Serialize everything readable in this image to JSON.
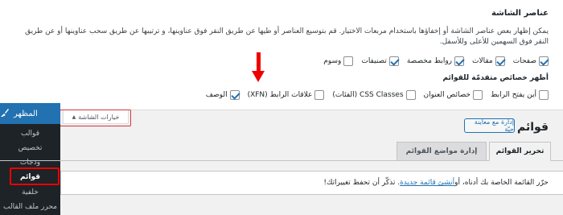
{
  "screen_options": {
    "title": "عناصر الشاشة",
    "description": "يمكن إظهار بعض عناصر الشاشة أو إخفاؤها باستخدام مربعات الاختيار. قم بتوسيع العناصر أو طيها عن طريق النقر فوق عناوينها، و ترتيبها عن طريق سحب عناوينها أو عن طريق النقر فوق السهمين للأعلى وللأسفل.",
    "boxes": [
      {
        "label": "صفحات",
        "checked": true
      },
      {
        "label": "مقالات",
        "checked": true
      },
      {
        "label": "روابط مخصصة",
        "checked": true
      },
      {
        "label": "تصنيفات",
        "checked": true
      },
      {
        "label": "وسوم",
        "checked": false
      }
    ],
    "advanced_title": "أظهر خصائص متقدمّة للقوائم",
    "advanced": [
      {
        "label": "أين يفتح الرابط",
        "checked": false
      },
      {
        "label": "خصائص العنوان",
        "checked": false
      },
      {
        "label": "CSS Classes (الفئات)",
        "checked": false
      },
      {
        "label": "علاقات الرابط (XFN)",
        "checked": false
      },
      {
        "label": "الوصف",
        "checked": true
      }
    ],
    "toggle_label": "خيارات الشاشة",
    "toggle_icon": "arrow-up-icon"
  },
  "sidebar": {
    "menu_label": "المظهر",
    "menu_icon": "paintbrush-icon",
    "items": [
      {
        "label": "قوالب",
        "current": false
      },
      {
        "label": "تخصيص",
        "current": false
      },
      {
        "label": "ودجات",
        "current": false
      },
      {
        "label": "قوائم",
        "current": true
      },
      {
        "label": "خلفية",
        "current": false
      },
      {
        "label": "محرر ملف القالب",
        "current": false
      }
    ]
  },
  "page": {
    "title": "قوائم",
    "manage_button": "إدارة مع معاينة حيّة",
    "tabs": [
      {
        "label": "تحرير القوائم",
        "active": true
      },
      {
        "label": "إدارة مواضع القوائم",
        "active": false
      }
    ],
    "notice": {
      "prefix": "حرّر القائمة الخاصة بك أدناه، أو ",
      "link": "أنشئ قائمة جديدة",
      "suffix": ". تذكّر أن تحفظ تغييراتك!"
    }
  },
  "colors": {
    "accent": "#2271b1",
    "sidebar_bg": "#1d2327",
    "highlight_red": "#e00000"
  }
}
